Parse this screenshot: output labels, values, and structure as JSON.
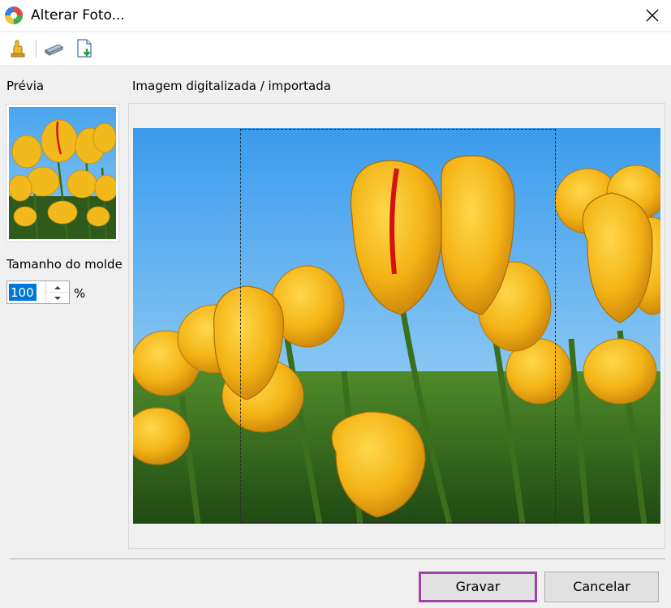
{
  "window": {
    "title": "Alterar Foto...",
    "icons": {
      "app": "color-wheel-icon",
      "close": "close-icon"
    }
  },
  "toolbar": {
    "items": [
      {
        "icon": "hand-acquire-icon",
        "tooltip": ""
      },
      {
        "icon": "scanner-icon",
        "tooltip": ""
      },
      {
        "icon": "import-file-icon",
        "tooltip": ""
      }
    ]
  },
  "left": {
    "preview_label": "Prévia",
    "size_label": "Tamanho do molde",
    "size_value": "100",
    "size_unit": "%"
  },
  "main": {
    "image_label": "Imagem digitalizada / importada"
  },
  "buttons": {
    "save": "Gravar",
    "cancel": "Cancelar"
  },
  "colors": {
    "accent_focus": "#a043a6",
    "selection": "#0078d7"
  }
}
